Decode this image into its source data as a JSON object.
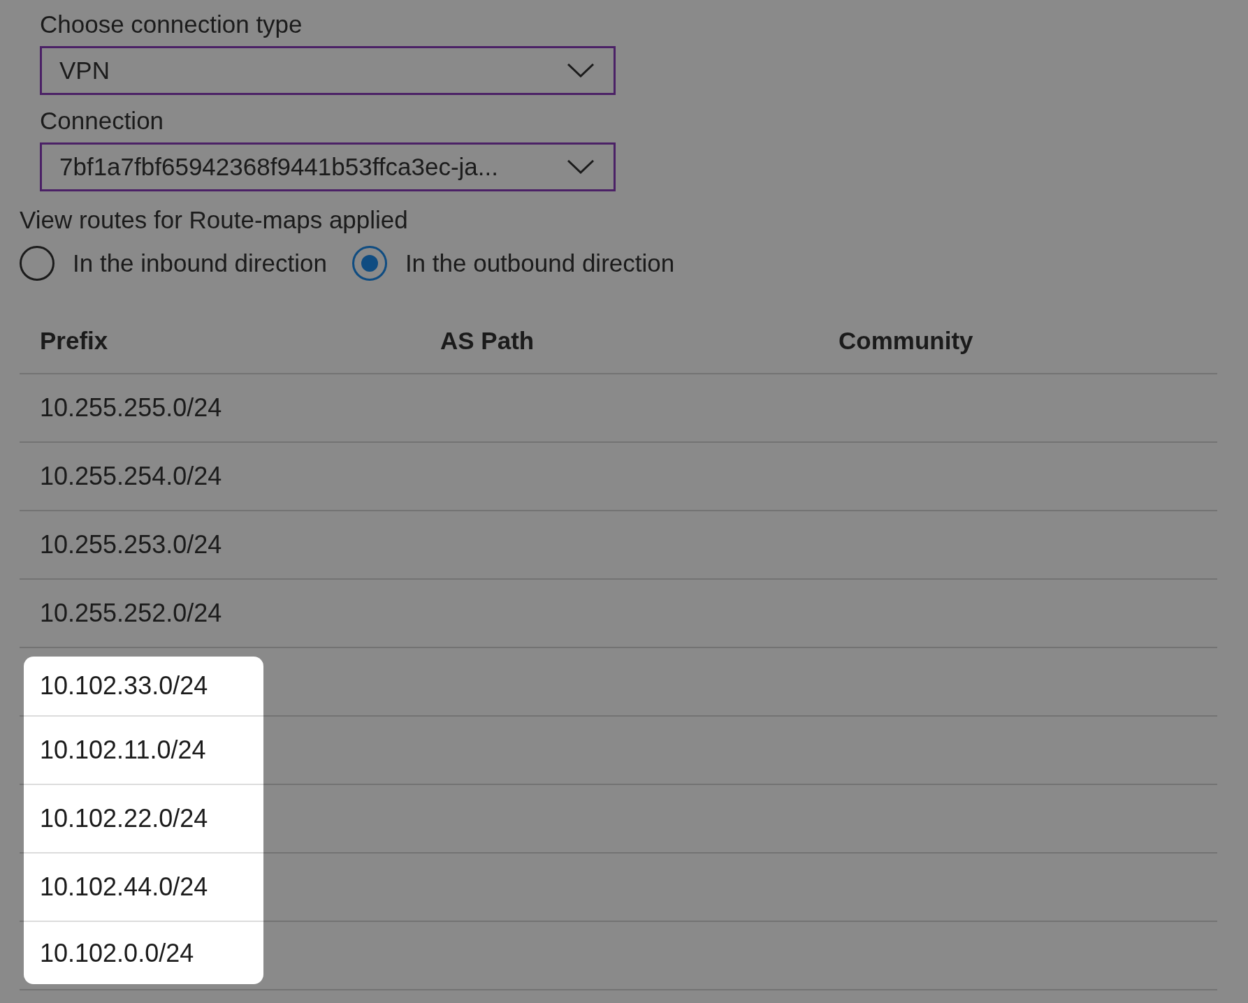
{
  "connection_type": {
    "label": "Choose connection type",
    "value": "VPN"
  },
  "connection": {
    "label": "Connection",
    "value": "7bf1a7fbf65942368f9441b53ffca3ec-ja..."
  },
  "direction": {
    "label": "View routes for Route-maps applied",
    "options": [
      {
        "label": "In the inbound direction",
        "selected": false
      },
      {
        "label": "In the outbound direction",
        "selected": true
      }
    ]
  },
  "table": {
    "columns": [
      "Prefix",
      "AS Path",
      "Community"
    ],
    "rows": [
      {
        "prefix": "10.255.255.0/24",
        "highlighted": false
      },
      {
        "prefix": "10.255.254.0/24",
        "highlighted": false
      },
      {
        "prefix": "10.255.253.0/24",
        "highlighted": false
      },
      {
        "prefix": "10.255.252.0/24",
        "highlighted": false
      },
      {
        "prefix": "10.102.33.0/24",
        "highlighted": true
      },
      {
        "prefix": "10.102.11.0/24",
        "highlighted": true
      },
      {
        "prefix": "10.102.22.0/24",
        "highlighted": true
      },
      {
        "prefix": "10.102.44.0/24",
        "highlighted": true
      },
      {
        "prefix": "10.102.0.0/24",
        "highlighted": true
      }
    ]
  }
}
